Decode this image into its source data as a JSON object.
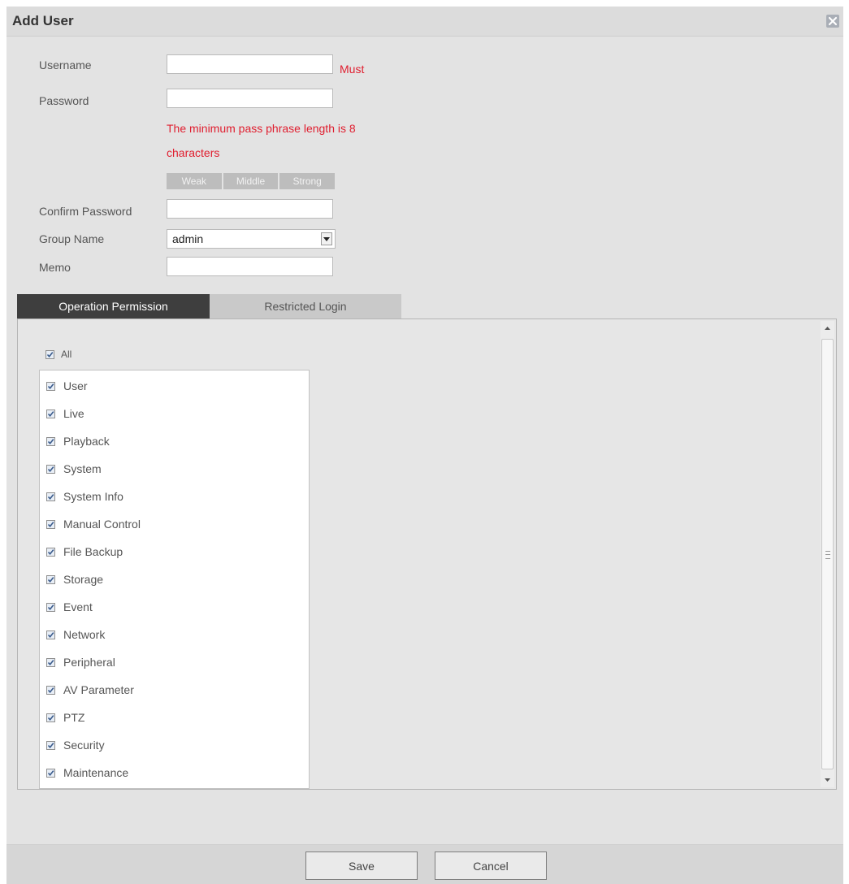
{
  "dialog": {
    "title": "Add User"
  },
  "form": {
    "username": {
      "label": "Username",
      "value": "",
      "required_note": "Must"
    },
    "password": {
      "label": "Password",
      "value": "",
      "hint_line1": "The minimum pass phrase length is 8",
      "hint_line2": "characters"
    },
    "strength": {
      "weak": "Weak",
      "middle": "Middle",
      "strong": "Strong"
    },
    "confirm_password": {
      "label": "Confirm Password",
      "value": ""
    },
    "group_name": {
      "label": "Group Name",
      "selected": "admin"
    },
    "memo": {
      "label": "Memo",
      "value": ""
    }
  },
  "tabs": [
    {
      "label": "Operation Permission",
      "active": true
    },
    {
      "label": "Restricted Login",
      "active": false
    }
  ],
  "permissions": {
    "all_label": "All",
    "all_checked": true,
    "items": [
      {
        "label": "User",
        "checked": true
      },
      {
        "label": "Live",
        "checked": true
      },
      {
        "label": "Playback",
        "checked": true
      },
      {
        "label": "System",
        "checked": true
      },
      {
        "label": "System Info",
        "checked": true
      },
      {
        "label": "Manual Control",
        "checked": true
      },
      {
        "label": "File Backup",
        "checked": true
      },
      {
        "label": "Storage",
        "checked": true
      },
      {
        "label": "Event",
        "checked": true
      },
      {
        "label": "Network",
        "checked": true
      },
      {
        "label": "Peripheral",
        "checked": true
      },
      {
        "label": "AV Parameter",
        "checked": true
      },
      {
        "label": "PTZ",
        "checked": true
      },
      {
        "label": "Security",
        "checked": true
      },
      {
        "label": "Maintenance",
        "checked": true
      }
    ]
  },
  "footer": {
    "save_label": "Save",
    "cancel_label": "Cancel"
  },
  "colors": {
    "required": "#e01e2f",
    "active_tab": "#3e3e3e",
    "dialog_bg": "#e3e3e3"
  },
  "icons": {
    "close": "close-icon",
    "dropdown": "chevron-down-icon",
    "check": "checkmark-icon"
  }
}
